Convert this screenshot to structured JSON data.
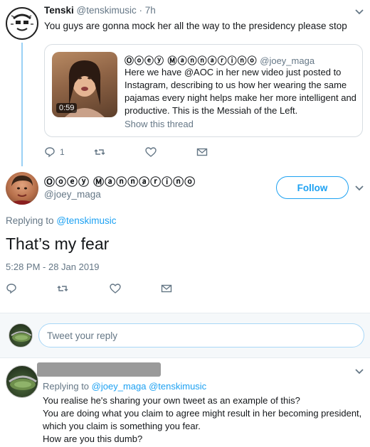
{
  "top_tweet": {
    "name": "Tenski",
    "handle": "@tenskimusic",
    "time": "· 7h",
    "text": "You guys are gonna mock her all the way to the presidency please stop",
    "quote": {
      "name": "Ⓞⓞⓔⓨ Ⓜⓐⓝⓝⓐⓡⓘⓝⓞ",
      "handle": "@joey_maga",
      "text": "Here we have @AOC in her new video just posted to Instagram, describing to us how her wearing the same pajamas every night helps make her more intelligent and productive. This is the Messiah of the Left.",
      "video_duration": "0:59",
      "show_thread": "Show this thread"
    },
    "actions": {
      "reply_count": "1"
    }
  },
  "main_tweet": {
    "name": "Ⓞⓞⓔⓨ Ⓜⓐⓝⓝⓐⓡⓘⓝⓞ",
    "handle": "@joey_maga",
    "follow_label": "Follow",
    "replying_prefix": "Replying to",
    "replying_handle": "@tenskimusic",
    "text": "That’s my fear",
    "timestamp": "5:28 PM - 28 Jan 2019"
  },
  "compose": {
    "placeholder": "Tweet your reply"
  },
  "reply_tweet": {
    "replying_prefix": "Replying to",
    "replying_handles": "@joey_maga @tenskimusic",
    "lines": [
      "You realise he's sharing your own tweet as an example of this?",
      "You are doing what you claim to agree might result in her becoming president,",
      "which you claim is something you fear.",
      "How are you this dumb?"
    ]
  },
  "colors": {
    "accent": "#1da1f2",
    "muted": "#657786",
    "thread_line": "#9ad0f5",
    "border": "#d7dde2"
  },
  "icons": {
    "reply": "reply-icon",
    "retweet": "retweet-icon",
    "like": "heart-icon",
    "dm": "envelope-icon",
    "more": "chevron-down-icon"
  }
}
